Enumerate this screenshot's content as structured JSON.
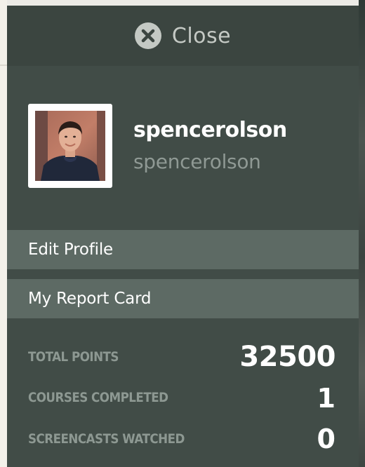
{
  "close": {
    "label": "Close",
    "icon": "close-icon"
  },
  "profile": {
    "avatar": "avatar-photo",
    "display_name": "spencerolson",
    "username": "spencerolson"
  },
  "menu": {
    "items": [
      {
        "label": "Edit Profile"
      },
      {
        "label": "My Report Card"
      }
    ]
  },
  "stats": [
    {
      "label": "TOTAL POINTS",
      "value": "32500"
    },
    {
      "label": "COURSES COMPLETED",
      "value": "1"
    },
    {
      "label": "SCREENCASTS WATCHED",
      "value": "0"
    }
  ],
  "colors": {
    "panel": "#414c47",
    "close_bar": "#3b4540",
    "menu_item": "#5d6a64",
    "muted_text": "#8d9892",
    "white_text": "#ffffff"
  }
}
